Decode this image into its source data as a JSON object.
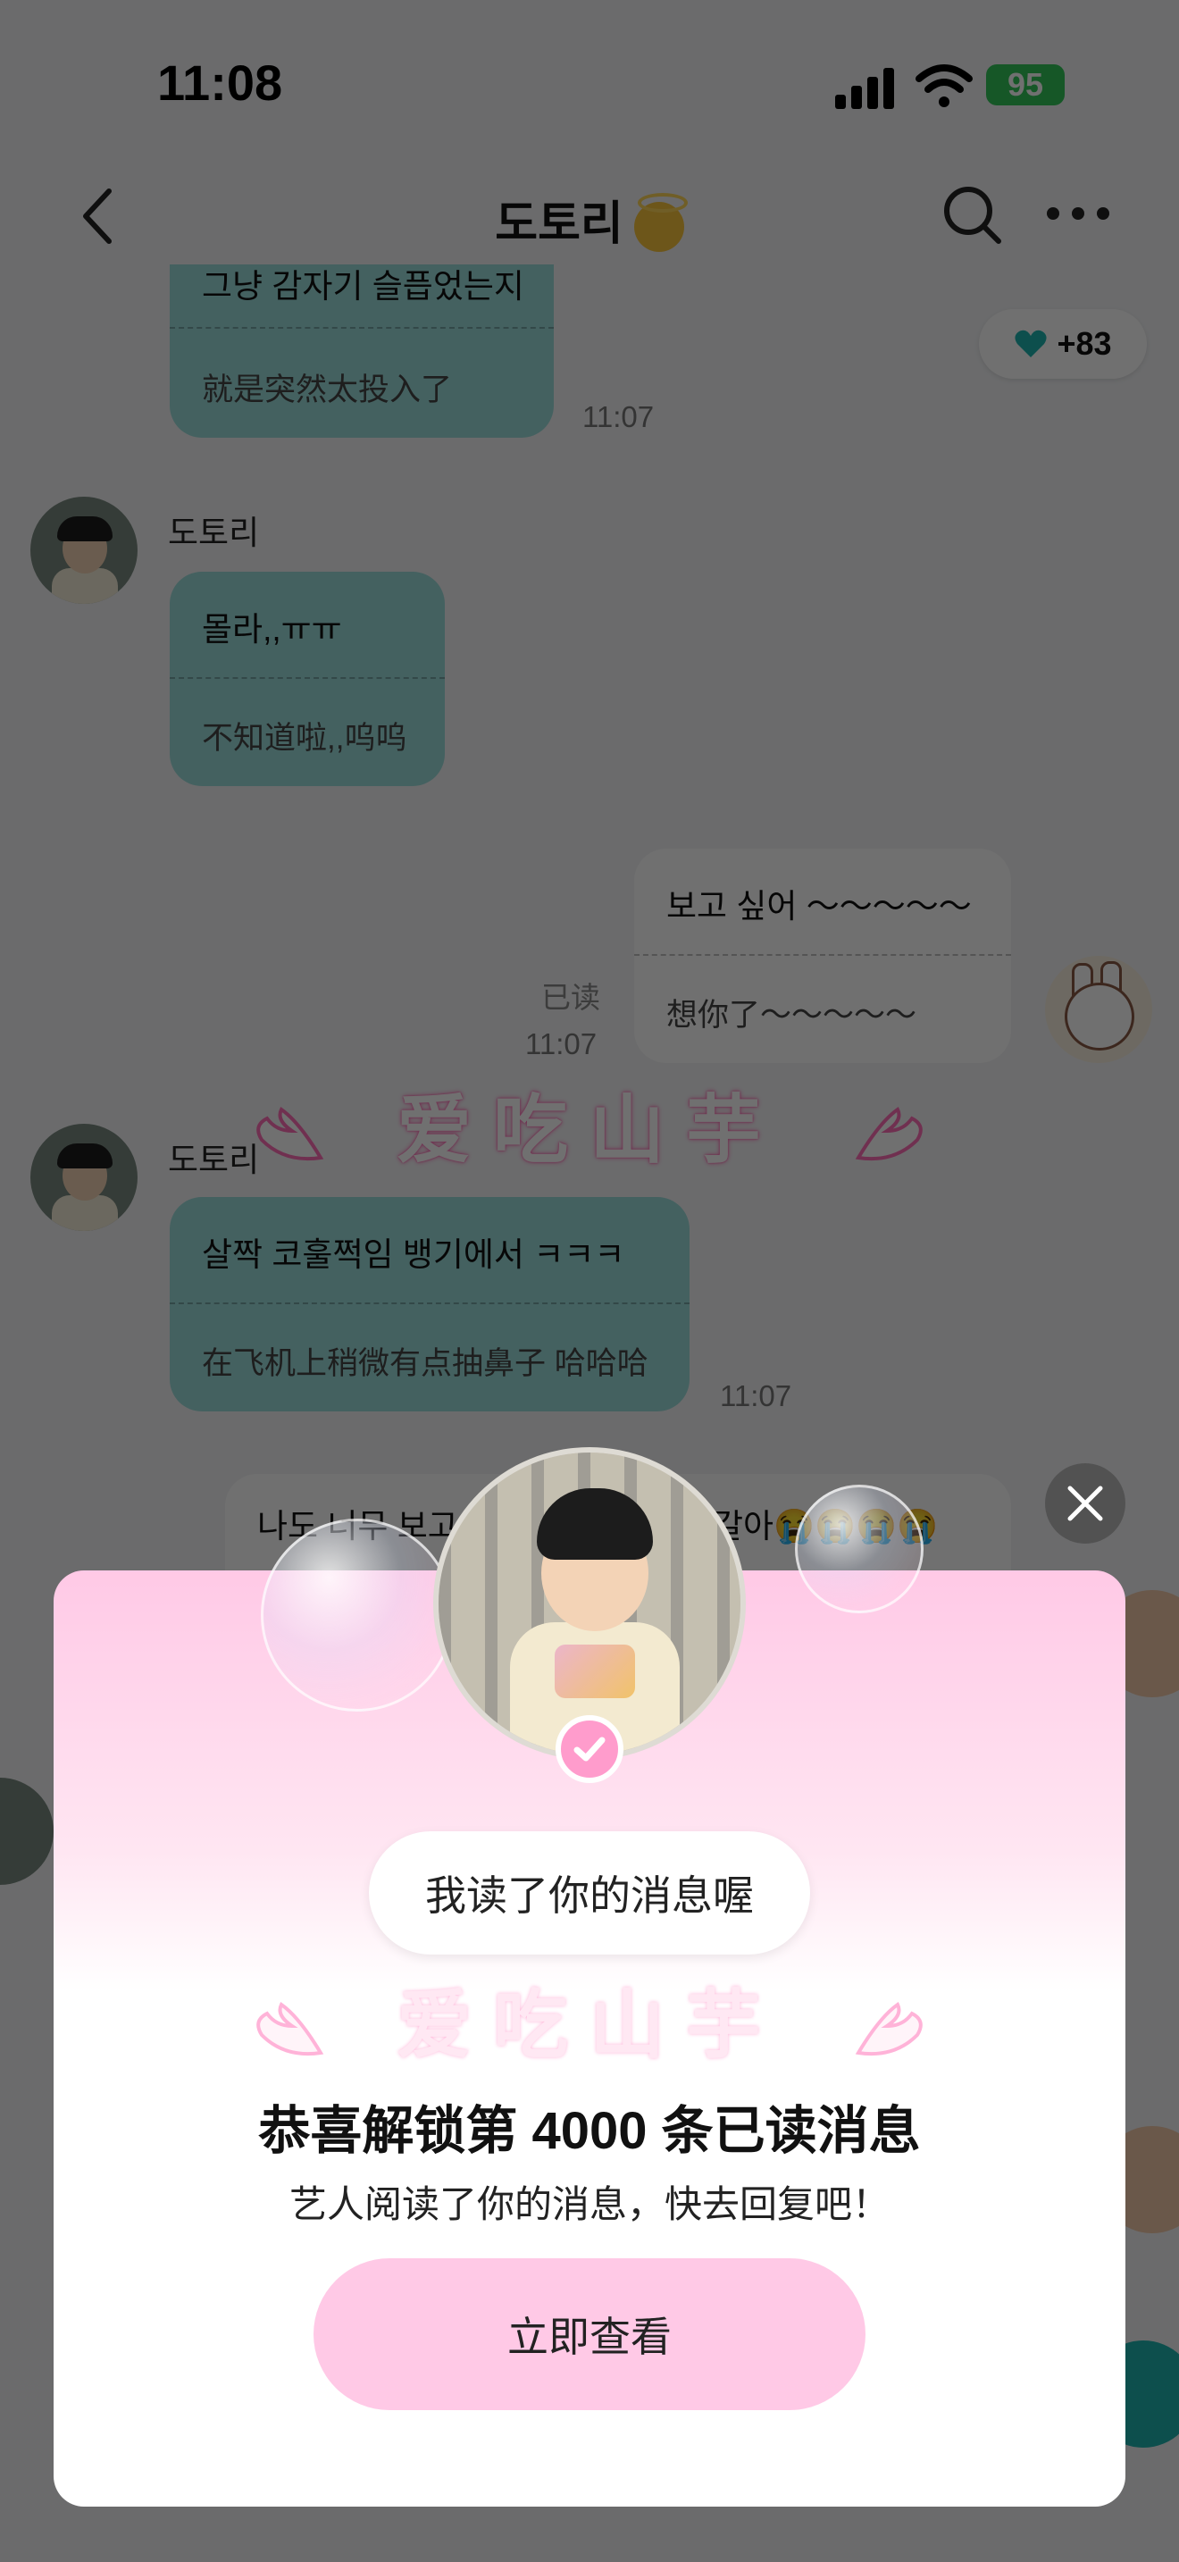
{
  "status_bar": {
    "time": "11:08",
    "battery": "95"
  },
  "header": {
    "title": "도토리",
    "back_icon": "chevron-left-icon",
    "search_icon": "search-icon",
    "more_icon": "more-icon"
  },
  "heart_count": "+83",
  "messages": [
    {
      "orig": "그냥 감자기 슬픕었는지",
      "trans": "就是突然太投入了",
      "time": "11:07"
    },
    {
      "sender": "도토리",
      "orig": "몰라,,ㅠㅠ",
      "trans": "不知道啦,,呜呜"
    },
    {
      "orig": "보고 싶어 ～～～～～",
      "trans": "想你了～～～～～",
      "read": "已读",
      "time": "11:07"
    },
    {
      "sender": "도토리",
      "orig": "살짝 코훌쩍임 뱅기에서 ㅋㅋㅋ",
      "trans": "在飞机上稍微有点抽鼻子 哈哈哈",
      "time": "11:07"
    },
    {
      "orig": "나도 너무 보고 싶어서 죽을 것 같아😭😭😭😭",
      "orig_visible_left": "나도 너무 보고",
      "orig_visible_right": "갈아😭😭😭😭"
    }
  ],
  "pixel_banner": "爱吃山芋",
  "modal": {
    "read_pill": "我读了你的消息喔",
    "banner": "爱吃山芋",
    "congrats": "恭喜解锁第 4000 条已读消息",
    "subtext": "艺人阅读了你的消息，快去回复吧！",
    "cta": "立即查看",
    "close_icon": "close-icon"
  }
}
